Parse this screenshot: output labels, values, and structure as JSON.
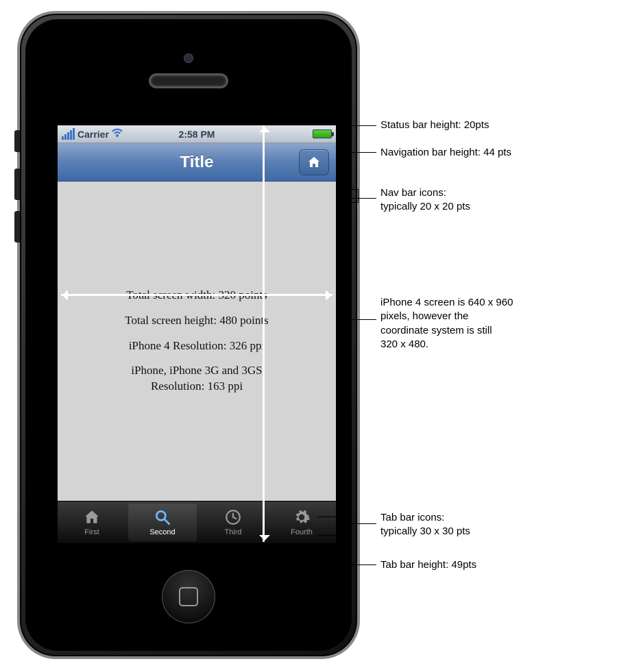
{
  "statusbar": {
    "carrier": "Carrier",
    "time": "2:58 PM"
  },
  "navbar": {
    "title": "Title"
  },
  "content": {
    "line1": "Total screen width: 320 points",
    "line2": "Total screen height: 480 points",
    "line3": "iPhone 4 Resolution: 326 ppi",
    "line4a": "iPhone, iPhone 3G and 3GS",
    "line4b": "Resolution: 163 ppi"
  },
  "tabs": {
    "first": "First",
    "second": "Second",
    "third": "Third",
    "fourth": "Fourth"
  },
  "annotations": {
    "status": "Status bar height: 20pts",
    "nav": "Navigation bar height: 44 pts",
    "navicons_a": "Nav bar icons:",
    "navicons_b": "typically 20 x 20 pts",
    "screen_a": "iPhone 4 screen is 640 x 960",
    "screen_b": "pixels, however the",
    "screen_c": "coordinate system is still",
    "screen_d": "320 x 480.",
    "tabicons_a": "Tab bar icons:",
    "tabicons_b": "typically 30 x 30 pts",
    "tabbar": "Tab bar height: 49pts"
  }
}
